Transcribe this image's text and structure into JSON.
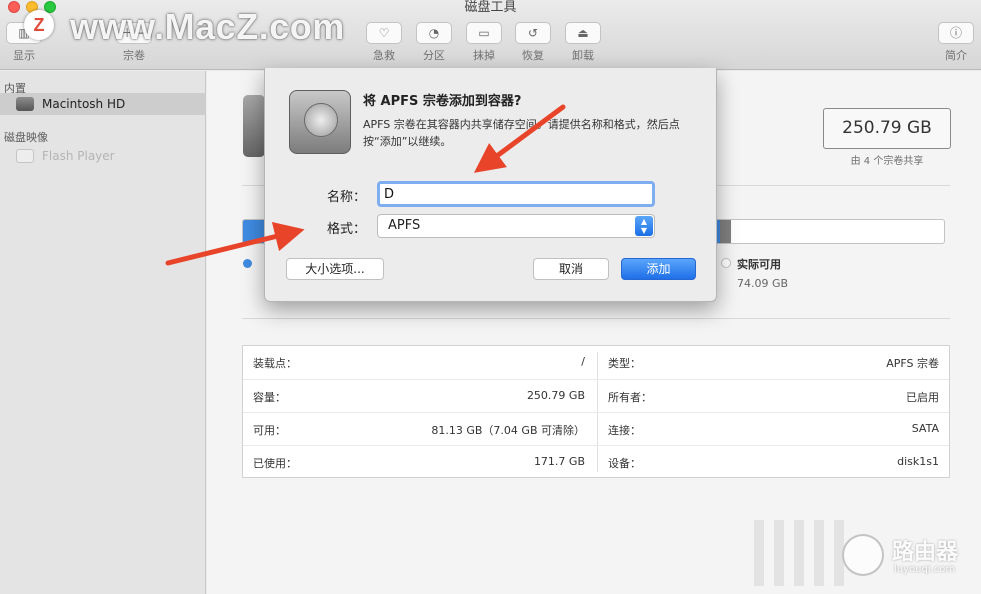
{
  "window": {
    "title": "磁盘工具"
  },
  "watermark": {
    "logo_letter": "Z",
    "text": "www.MacZ.com"
  },
  "toolbar": {
    "view_label": "显示",
    "volume_label": "宗卷",
    "firstaid_label": "急救",
    "partition_label": "分区",
    "erase_label": "抹掉",
    "restore_label": "恢复",
    "unmount_label": "卸载",
    "info_label": "简介"
  },
  "sidebar": {
    "internal_header": "内置",
    "internal_items": [
      {
        "label": "Macintosh HD",
        "selected": true
      }
    ],
    "images_header": "磁盘映像",
    "image_items": [
      {
        "label": "Flash Player",
        "dimmed": true
      }
    ]
  },
  "summary": {
    "capacity": "250.79 GB",
    "shared_note": "由 4 个宗卷共享"
  },
  "usage": {
    "used_fraction": 0.68,
    "other_fraction": 0.016,
    "free_label": "实际可用",
    "free_value": "74.09 GB"
  },
  "info": {
    "rows": [
      {
        "label": "装载点：",
        "value": "/",
        "label2": "类型：",
        "value2": "APFS 宗卷"
      },
      {
        "label": "容量：",
        "value": "250.79 GB",
        "label2": "所有者：",
        "value2": "已启用"
      },
      {
        "label": "可用：",
        "value": "81.13 GB（7.04 GB 可清除）",
        "label2": "连接：",
        "value2": "SATA"
      },
      {
        "label": "已使用：",
        "value": "171.7 GB",
        "label2": "设备：",
        "value2": "disk1s1"
      }
    ]
  },
  "dialog": {
    "title": "将 APFS 宗卷添加到容器?",
    "message": "APFS 宗卷在其容器内共享储存空间。请提供名称和格式，然后点按“添加”以继续。",
    "name_label": "名称：",
    "name_value": "D",
    "format_label": "格式：",
    "format_value": "APFS",
    "size_options_button": "大小选项...",
    "cancel_button": "取消",
    "add_button": "添加"
  },
  "corner_watermark": {
    "name": "路由器",
    "url": "luyouqi.com"
  },
  "colors": {
    "accent_blue": "#3f8be2",
    "arrow_red": "#e8442a",
    "add_button": "#1f6fe8"
  }
}
